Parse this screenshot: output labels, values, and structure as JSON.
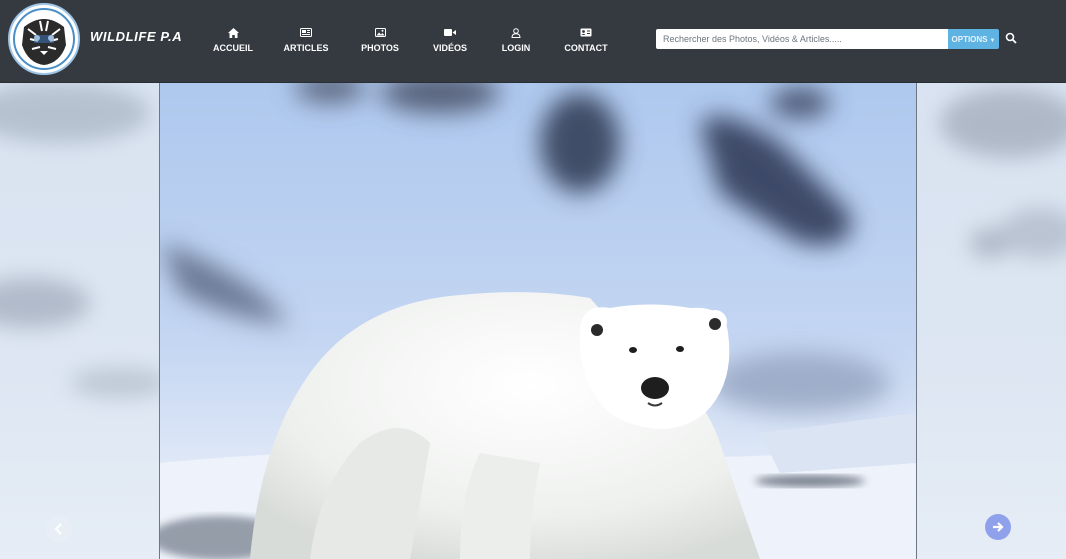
{
  "brand": {
    "name": "WILDLIFE P.A",
    "logo_icon": "tiger-logo-icon"
  },
  "nav": {
    "items": [
      {
        "label": "ACCUEIL",
        "icon": "home-icon"
      },
      {
        "label": "ARTICLES",
        "icon": "newspaper-icon"
      },
      {
        "label": "PHOTOS",
        "icon": "image-icon"
      },
      {
        "label": "VIDÉOS",
        "icon": "video-camera-icon"
      },
      {
        "label": "LOGIN",
        "icon": "user-icon"
      },
      {
        "label": "CONTACT",
        "icon": "contact-card-icon"
      }
    ]
  },
  "search": {
    "placeholder": "Rechercher des Photos, Vidéos & Articles.....",
    "value": "",
    "options_label": "OPTIONS",
    "icon": "search-icon"
  },
  "carousel": {
    "slide_icon": "polar-bear-photo",
    "prev_icon": "chevron-left-icon",
    "next_icon": "arrow-right-icon"
  },
  "colors": {
    "navbar_bg": "#343a40",
    "accent": "#5fb3e3",
    "next_button": "#8fa1ea"
  }
}
